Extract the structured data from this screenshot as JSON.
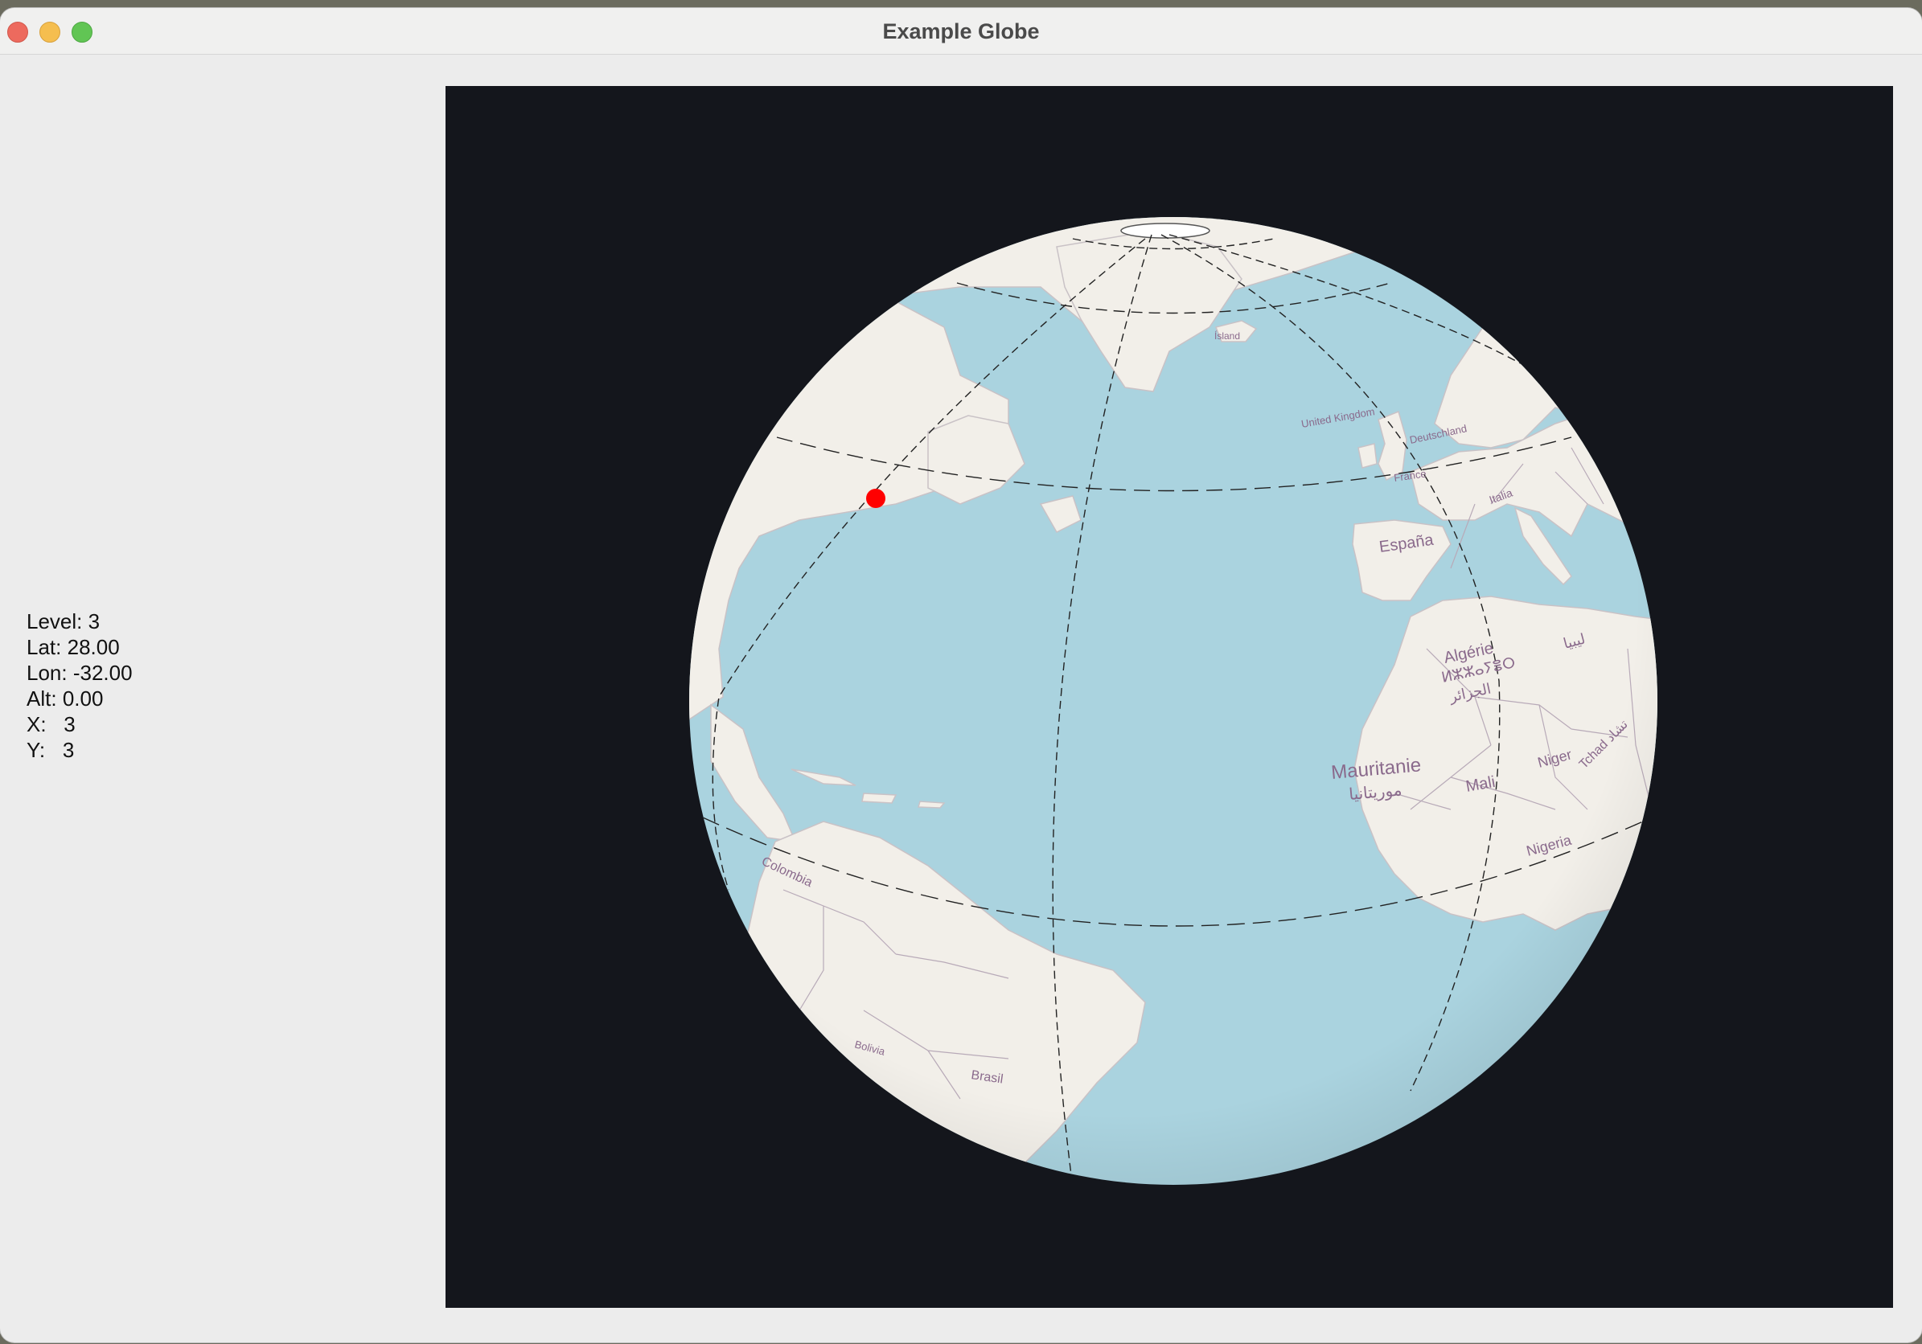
{
  "window": {
    "title": "Example Globe"
  },
  "info": {
    "level_label": "Level:",
    "level": "3",
    "lat_label": "Lat:",
    "lat": "28.00",
    "lon_label": "Lon:",
    "lon": "-32.00",
    "alt_label": "Alt:",
    "alt": "0.00",
    "x_label": "X:",
    "x": "3",
    "y_label": "Y:",
    "y": "3"
  },
  "map_labels": {
    "island": "Ísland",
    "united_kingdom": "United Kingdom",
    "deutschland": "Deutschland",
    "france": "France",
    "espana": "España",
    "italia": "Italia",
    "algerie": "Algérie",
    "algerie_tifinagh": "ⵍⵣⵣⴰⵢⴻⵔ",
    "algerie_arabic": "الجزائر",
    "libya_arabic": "ليبيا",
    "mauritanie": "Mauritanie",
    "mauritanie_arabic": "موريتانيا",
    "mali": "Mali",
    "niger": "Niger",
    "tchad": "Tchad تشاد",
    "nigeria": "Nigeria",
    "colombia": "Colombia",
    "bolivia": "Bolivia",
    "brasil": "Brasil"
  },
  "marker": {
    "color": "#ff0000"
  },
  "colors": {
    "ocean": "#aad3df",
    "land": "#f2efe9",
    "space": "#14161c",
    "label": "#8a6a8c"
  }
}
